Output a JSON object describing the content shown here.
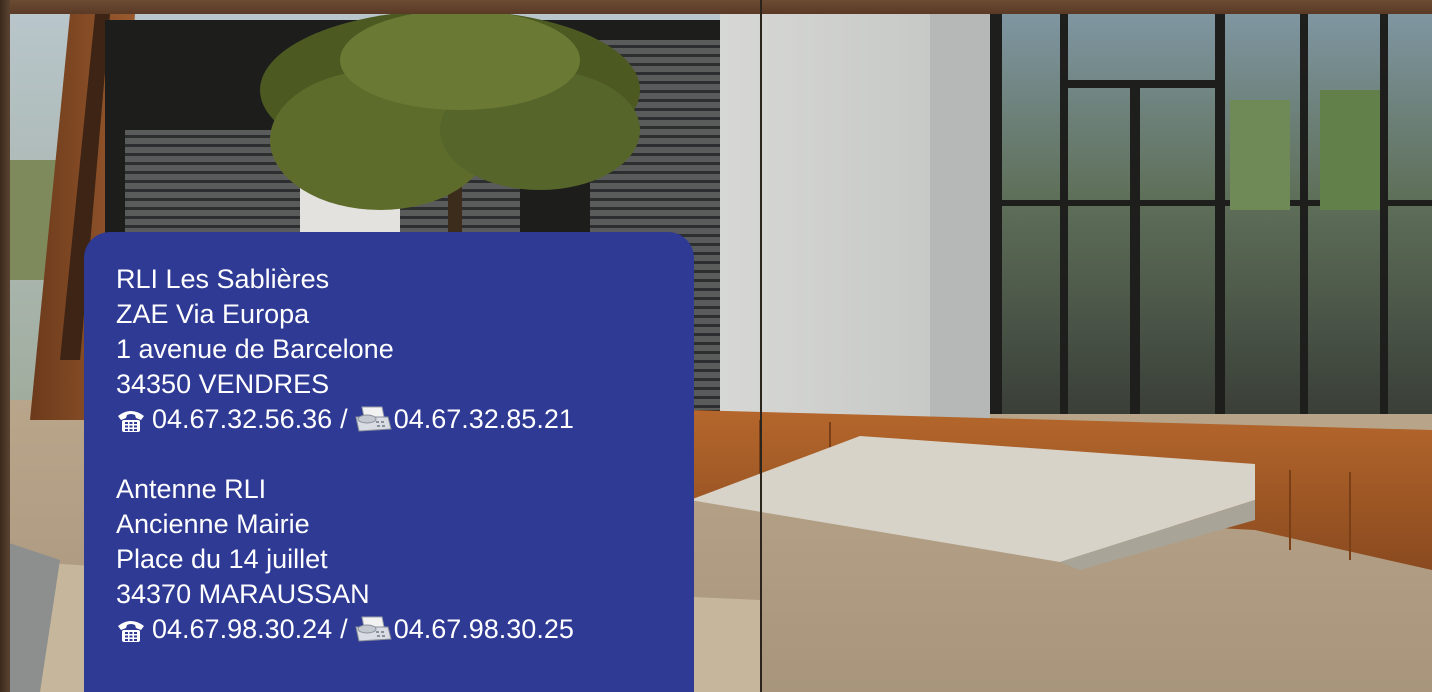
{
  "card": {
    "main_office": {
      "name": "RLI Les Sablières",
      "zone": "ZAE Via Europa",
      "street": "1 avenue de Barcelone",
      "city": "34350 VENDRES",
      "phone": "04.67.32.56.36",
      "separator": "/",
      "fax": "04.67.32.85.21",
      "phone_icon": "telephone-icon",
      "fax_icon": "fax-machine-icon"
    },
    "antenna": {
      "name": "Antenne RLI",
      "building": "Ancienne Mairie",
      "street": "Place du 14 juillet",
      "city": "34370 MARAUSSAN",
      "phone": "04.67.98.30.24",
      "separator": "/",
      "fax": "04.67.98.30.25",
      "phone_icon": "telephone-icon",
      "fax_icon": "fax-machine-icon"
    },
    "background_color": "#2f3a94",
    "text_color": "#ffffff"
  }
}
